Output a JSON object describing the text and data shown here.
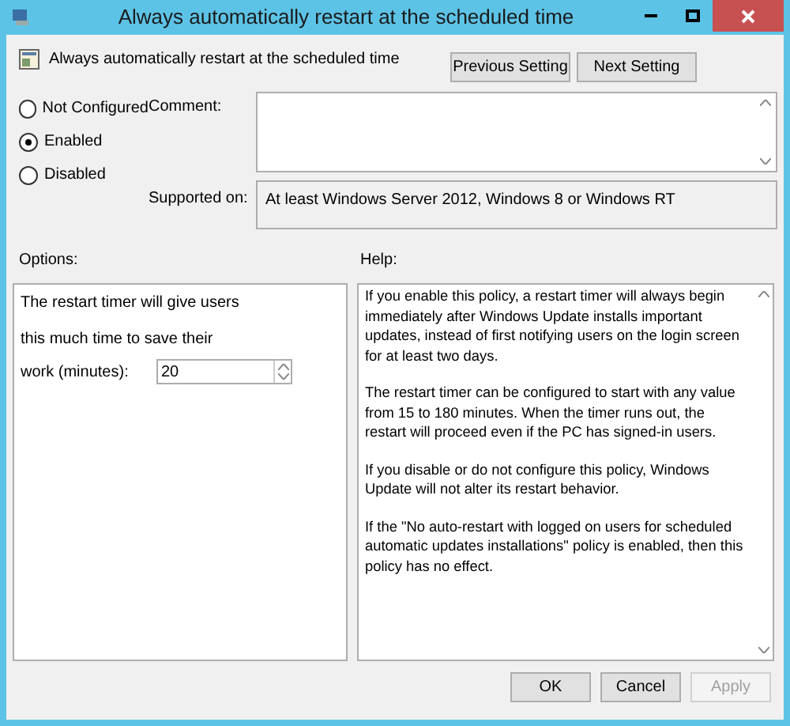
{
  "window": {
    "title": "Always automatically restart at the scheduled time"
  },
  "header": {
    "title": "Always automatically restart at the scheduled time",
    "buttons": [
      {
        "label": "Previous Setting",
        "disabled": false
      },
      {
        "label": "Next Setting",
        "disabled": false
      }
    ]
  },
  "state_options": [
    {
      "label": "Not Configured",
      "selected": false
    },
    {
      "label": "Enabled",
      "selected": true
    },
    {
      "label": "Disabled",
      "selected": false
    }
  ],
  "comment": {
    "label": "Comment:"
  },
  "supported_on": {
    "label": "Supported on:",
    "value": "At least Windows Server 2012, Windows 8 or Windows RT"
  },
  "options": {
    "label": "Options:",
    "lines": [
      "The restart timer will give users",
      "this much time to save their"
    ],
    "field_label": "work (minutes):",
    "field_value": "20"
  },
  "help": {
    "label": "Help:",
    "paragraphs": [
      "If you enable this policy, a restart timer will always begin immediately after Windows Update installs important updates, instead of first notifying users on the login screen for at least two days.",
      "The restart timer can be configured to start with any value from 15 to 180 minutes. When the timer runs out, the restart will proceed even if the PC has signed-in users.",
      "If you disable or do not configure this policy, Windows Update will not alter its restart behavior.",
      "If the \"No auto-restart with logged on users for scheduled automatic updates installations\" policy is enabled, then this policy has no effect."
    ]
  },
  "footer": {
    "buttons": [
      {
        "label": "OK",
        "disabled": false
      },
      {
        "label": "Cancel",
        "disabled": false
      },
      {
        "label": "Apply",
        "disabled": true
      }
    ]
  }
}
